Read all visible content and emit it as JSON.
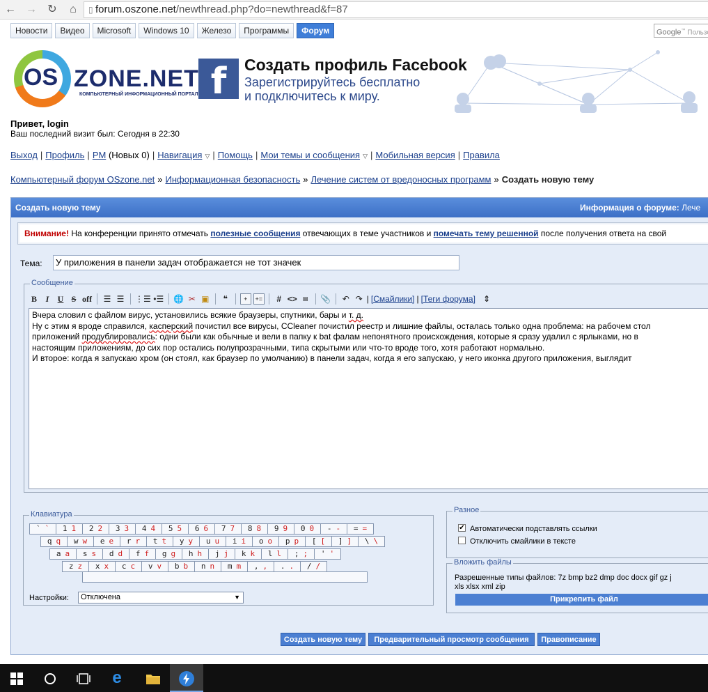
{
  "browser": {
    "url_host": "forum.oszone.net",
    "url_path": "/newthread.php?do=newthread&f=87"
  },
  "site_tabs": [
    "Новости",
    "Видео",
    "Microsoft",
    "Windows 10",
    "Железо",
    "Программы",
    "Форум"
  ],
  "google_search": {
    "brand": "Google",
    "placeholder": "Пользо"
  },
  "logo": {
    "os": "OS",
    "zone_a": "ZONE",
    "zone_b": ".NET",
    "tagline": "КОМПЬЮТЕРНЫЙ ИНФОРМАЦИОННЫЙ ПОРТАЛ"
  },
  "ad": {
    "title": "Создать профиль Facebook",
    "sub1": "Зарегистрируйтесь бесплатно",
    "sub2": "и подключитесь к миру."
  },
  "user": {
    "greeting": "Привет, login",
    "last_visit": "Ваш последний визит был: Сегодня в 22:30"
  },
  "usernav": {
    "logout": "Выход",
    "profile": "Профиль",
    "pm": "PM",
    "pm_new": "(Новых 0)",
    "navigation": "Навигация",
    "help": "Помощь",
    "my_threads": "Мои темы и сообщения",
    "mobile": "Мобильная версия",
    "rules": "Правила"
  },
  "breadcrumb": {
    "items": [
      "Компьютерный форум OSzone.net",
      "Информационная безопасность",
      "Лечение систем от вредоносных программ"
    ],
    "separator": "»",
    "current": "Создать новую тему"
  },
  "panel": {
    "title": "Создать новую тему",
    "info_label": "Информация о форуме:",
    "info_value": "Лече"
  },
  "notice": {
    "warning": "Внимание!",
    "text1": "На конференции принято отмечать",
    "link1": "полезные сообщения",
    "text2": "отвечающих в теме участников и",
    "link2": "помечать тему решенной",
    "text3": "после получения ответа на свой"
  },
  "subject": {
    "label": "Тема:",
    "value": "У приложения в панели задач отображается не тот значек"
  },
  "message": {
    "legend": "Сообщение",
    "toolbar": {
      "bold": "B",
      "italic": "I",
      "underline": "U",
      "strike": "S",
      "off": "off",
      "smilies": "[Смайлики]",
      "tags": "[Теги форума]",
      "sep_pipe": "|",
      "resize": "⇕"
    },
    "lines": [
      "Вчера словил с файлом вирус, установились всякие браузеры, спутники, бары и т. д.",
      "Ну с этим я вроде справился, касперский почистил все вирусы, CCleaner почистил реестр и лишние файлы, осталась только одна проблема: на рабочем стол",
      "приложений продублировались: одни были как обычные и вели в папку к bat фалам непонятного происхождения, которые я сразу удалил с ярлыками, но в",
      "настоящим приложениям, до сих пор остались полупрозрачными, типа скрытыми или что-то вроде того, хотя работают нормально.",
      "И второе: когда я запускаю хром (он стоял, как браузер по умолчанию) в панели задач, когда я его запускаю, у него иконка другого приложения, выглядит"
    ]
  },
  "keyboard": {
    "legend": "Клавиатура",
    "rows": [
      [
        [
          "`",
          "`"
        ],
        [
          "1",
          "1"
        ],
        [
          "2",
          "2"
        ],
        [
          "3",
          "3"
        ],
        [
          "4",
          "4"
        ],
        [
          "5",
          "5"
        ],
        [
          "6",
          "6"
        ],
        [
          "7",
          "7"
        ],
        [
          "8",
          "8"
        ],
        [
          "9",
          "9"
        ],
        [
          "0",
          "0"
        ],
        [
          "-",
          "-"
        ],
        [
          "=",
          "="
        ]
      ],
      [
        [
          "q",
          "q"
        ],
        [
          "w",
          "w"
        ],
        [
          "e",
          "e"
        ],
        [
          "r",
          "r"
        ],
        [
          "t",
          "t"
        ],
        [
          "y",
          "y"
        ],
        [
          "u",
          "u"
        ],
        [
          "i",
          "i"
        ],
        [
          "o",
          "o"
        ],
        [
          "p",
          "p"
        ],
        [
          "[",
          "["
        ],
        [
          "]",
          "]"
        ],
        [
          "\\",
          "\\"
        ]
      ],
      [
        [
          "a",
          "a"
        ],
        [
          "s",
          "s"
        ],
        [
          "d",
          "d"
        ],
        [
          "f",
          "f"
        ],
        [
          "g",
          "g"
        ],
        [
          "h",
          "h"
        ],
        [
          "j",
          "j"
        ],
        [
          "k",
          "k"
        ],
        [
          "l",
          "l"
        ],
        [
          ";",
          ";"
        ],
        [
          "'",
          "'"
        ]
      ],
      [
        [
          "z",
          "z"
        ],
        [
          "x",
          "x"
        ],
        [
          "c",
          "c"
        ],
        [
          "v",
          "v"
        ],
        [
          "b",
          "b"
        ],
        [
          "n",
          "n"
        ],
        [
          "m",
          "m"
        ],
        [
          ",",
          ","
        ],
        [
          ".",
          "."
        ],
        [
          "/",
          "/"
        ]
      ]
    ],
    "settings_label": "Настройки:",
    "settings_value": "Отключена"
  },
  "misc": {
    "legend": "Разное",
    "auto_links": {
      "label": "Автоматически подставлять ссылки",
      "checked": true
    },
    "disable_smilies": {
      "label": "Отключить смайлики в тексте",
      "checked": false
    }
  },
  "attachments": {
    "legend": "Вложить файлы",
    "types_line1": "Разрешенные типы файлов: 7z bmp bz2 dmp doc docx gif gz j",
    "types_line2": "xls xlsx xml zip",
    "button": "Прикрепить файл"
  },
  "actions": {
    "submit": "Создать новую тему",
    "preview": "Предварительный просмотр сообщения",
    "spell": "Правописание"
  },
  "taskbar": {
    "items": [
      "windows-start",
      "cortana-search",
      "task-view",
      "edge",
      "file-explorer",
      "app-blue"
    ]
  }
}
